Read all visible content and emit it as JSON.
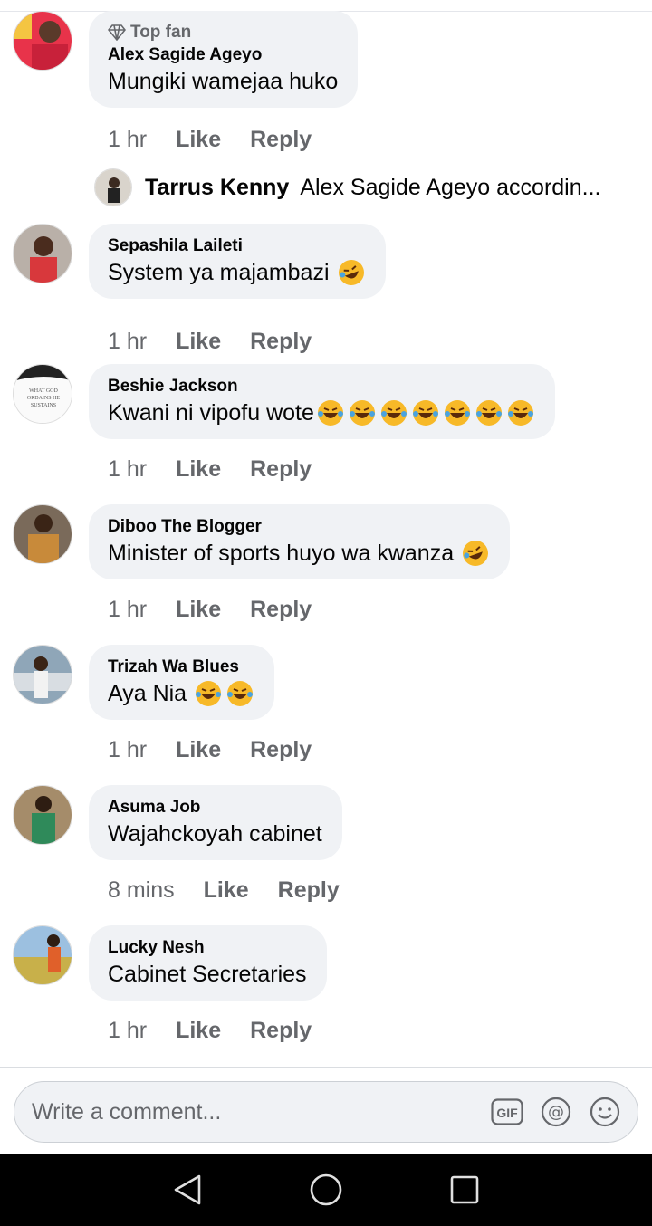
{
  "comments": [
    {
      "badge": "Top fan",
      "author": "Alex Sagide Ageyo",
      "text": "Mungiki wamejaa huko",
      "emoji_count": 0,
      "time": "1 hr",
      "like": "Like",
      "reply": "Reply"
    },
    {
      "author": "Sepashila Laileti",
      "text": "System ya majambazi",
      "emoji_count": 1,
      "time": "1 hr",
      "like": "Like",
      "reply": "Reply"
    },
    {
      "author": "Beshie Jackson",
      "text": "Kwani ni vipofu wote",
      "emoji_count": 7,
      "avatar_text": "WHAT GOD ORDAINS HE SUSTAINS",
      "time": "1 hr",
      "like": "Like",
      "reply": "Reply"
    },
    {
      "author": "Diboo The Blogger",
      "text": "Minister of sports huyo wa kwanza",
      "emoji_count": 1,
      "time": "1 hr",
      "like": "Like",
      "reply": "Reply"
    },
    {
      "author": "Trizah Wa Blues",
      "text": "Aya Nia",
      "emoji_count": 2,
      "time": "1 hr",
      "like": "Like",
      "reply": "Reply"
    },
    {
      "author": "Asuma Job",
      "text": "Wajahckoyah cabinet",
      "emoji_count": 0,
      "time": "8 mins",
      "like": "Like",
      "reply": "Reply"
    },
    {
      "author": "Lucky Nesh",
      "text": "Cabinet Secretaries",
      "emoji_count": 0,
      "time": "1 hr",
      "like": "Like",
      "reply": "Reply"
    }
  ],
  "reply_preview": {
    "author": "Tarrus Kenny",
    "text": "Alex Sagide Ageyo accordin..."
  },
  "composer": {
    "placeholder": "Write a comment...",
    "icons": [
      "gif-icon",
      "mention-icon",
      "emoji-icon"
    ]
  },
  "navbar": {
    "icons": [
      "back-icon",
      "home-icon",
      "recents-icon"
    ]
  },
  "colors": {
    "bubble": "#f0f2f5",
    "meta_text": "#65676b",
    "navbar": "#000000"
  }
}
